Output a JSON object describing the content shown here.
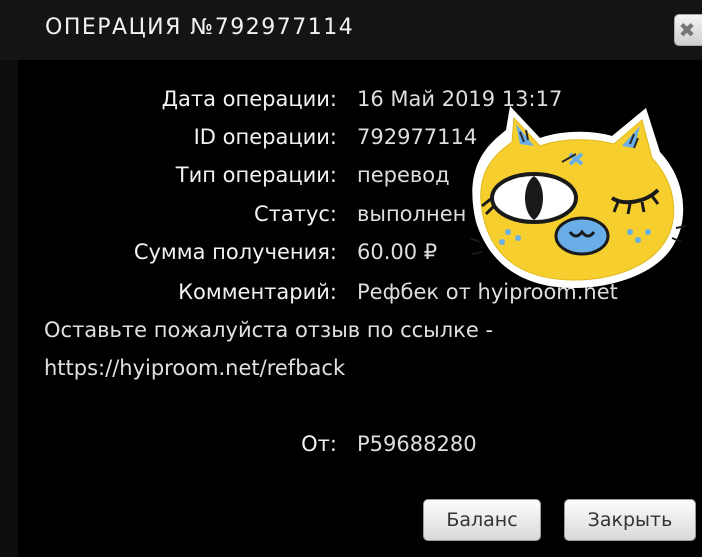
{
  "header": {
    "title": "ОПЕРАЦИЯ №792977114",
    "close_symbol": "✖"
  },
  "details": [
    {
      "label": "Дата операции:",
      "value": "16 Май 2019 13:17"
    },
    {
      "label": "ID операции:",
      "value": "792977114"
    },
    {
      "label": "Тип операции:",
      "value": "перевод"
    },
    {
      "label": "Статус:",
      "value": "выполнен"
    },
    {
      "label": "Сумма получения:",
      "value": "60.00 ₽"
    },
    {
      "label": "Комментарий:",
      "value": "Рефбек от hyiproom.net"
    }
  ],
  "comment_continued": [
    "Оставьте пожалуйста отзыв по ссылке -",
    "https://hyiproom.net/refback"
  ],
  "from": {
    "label": "От:",
    "value": "P59688280"
  },
  "buttons": {
    "balance": "Баланс",
    "close": "Закрыть"
  },
  "colors": {
    "background": "#000000",
    "sticker_yellow": "#f6cf2e",
    "sticker_blue": "#6aaee8"
  }
}
